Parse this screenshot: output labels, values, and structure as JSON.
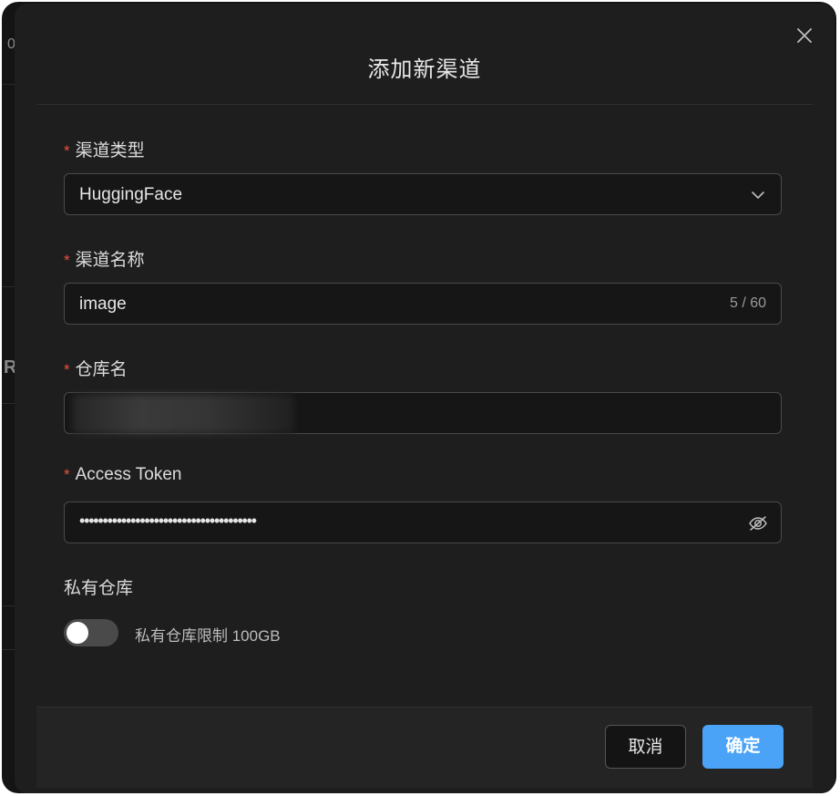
{
  "background": {
    "edge_texts": [
      "0",
      "R"
    ]
  },
  "dialog": {
    "title": "添加新渠道",
    "close_icon": "close-icon"
  },
  "fields": {
    "channel_type": {
      "required_mark": "*",
      "label": "渠道类型",
      "value": "HuggingFace"
    },
    "channel_name": {
      "required_mark": "*",
      "label": "渠道名称",
      "value": "image",
      "counter": "5 / 60"
    },
    "repo_name": {
      "required_mark": "*",
      "label": "仓库名"
    },
    "access_token": {
      "required_mark": "*",
      "label": "Access Token",
      "masked_value": "••••••••••••••••••••••••••••••••••••••"
    },
    "private_repo": {
      "label": "私有仓库",
      "toggle_on": false,
      "hint": "私有仓库限制 100GB"
    }
  },
  "footer": {
    "cancel_label": "取消",
    "ok_label": "确定"
  },
  "colors": {
    "accent": "#4aa3f7",
    "required": "#e5533d",
    "modal_bg": "#1e1e1e"
  }
}
